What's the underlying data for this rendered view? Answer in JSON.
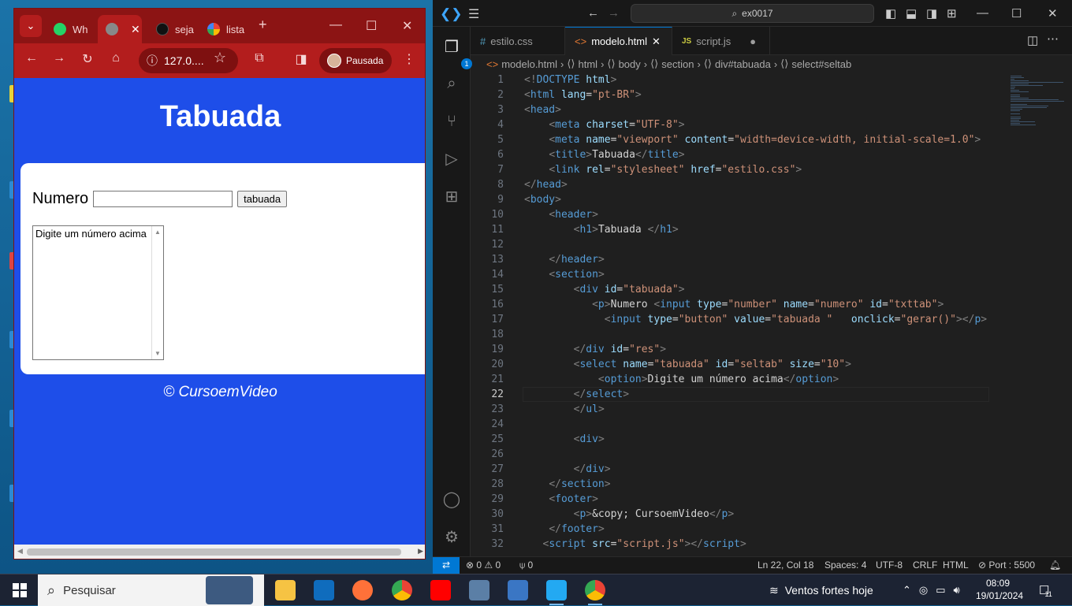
{
  "chrome": {
    "tabs": [
      {
        "label": "Wh",
        "icon": "whatsapp-icon",
        "active": false
      },
      {
        "label": "",
        "icon": "globe-icon",
        "active": true
      },
      {
        "label": "seja",
        "icon": "github-icon",
        "active": false
      },
      {
        "label": "lista",
        "icon": "google-icon",
        "active": false
      }
    ],
    "address": "127.0....",
    "profile_label": "Pausada",
    "page": {
      "title": "Tabuada",
      "number_label": "Numero",
      "button_label": "tabuada",
      "select_option": "Digite um número acima",
      "footer": "© CursoemVideo"
    },
    "accent": "#1e4ee9"
  },
  "vscode": {
    "command_center": "ex0017",
    "activity_badge": "1",
    "tabs": [
      {
        "label": "estilo.css",
        "icon": "#",
        "active": false
      },
      {
        "label": "modelo.html",
        "icon": "<>",
        "active": true
      },
      {
        "label": "script.js",
        "icon": "JS",
        "active": false
      }
    ],
    "breadcrumb": [
      "modelo.html",
      "html",
      "body",
      "section",
      "div#tabuada",
      "select#seltab"
    ],
    "lines": [
      {
        "n": "1",
        "parts": [
          [
            "t",
            "<!"
          ],
          [
            "tg",
            "DOCTYPE"
          ],
          [
            "at",
            " html"
          ],
          [
            "t",
            ">"
          ]
        ]
      },
      {
        "n": "2",
        "parts": [
          [
            "t",
            "<"
          ],
          [
            "tg",
            "html"
          ],
          [
            "at",
            " lang"
          ],
          [
            "tx",
            "="
          ],
          [
            "st",
            "\"pt-BR\""
          ],
          [
            "t",
            ">"
          ]
        ]
      },
      {
        "n": "3",
        "parts": [
          [
            "t",
            "<"
          ],
          [
            "tg",
            "head"
          ],
          [
            "t",
            ">"
          ]
        ]
      },
      {
        "n": "4",
        "parts": [
          [
            "tx",
            "    "
          ],
          [
            "t",
            "<"
          ],
          [
            "tg",
            "meta"
          ],
          [
            "at",
            " charset"
          ],
          [
            "tx",
            "="
          ],
          [
            "st",
            "\"UTF-8\""
          ],
          [
            "t",
            ">"
          ]
        ]
      },
      {
        "n": "5",
        "parts": [
          [
            "tx",
            "    "
          ],
          [
            "t",
            "<"
          ],
          [
            "tg",
            "meta"
          ],
          [
            "at",
            " name"
          ],
          [
            "tx",
            "="
          ],
          [
            "st",
            "\"viewport\""
          ],
          [
            "at",
            " content"
          ],
          [
            "tx",
            "="
          ],
          [
            "st",
            "\"width=device-width, initial-scale=1.0\""
          ],
          [
            "t",
            ">"
          ]
        ]
      },
      {
        "n": "6",
        "parts": [
          [
            "tx",
            "    "
          ],
          [
            "t",
            "<"
          ],
          [
            "tg",
            "title"
          ],
          [
            "t",
            ">"
          ],
          [
            "tx",
            "Tabuada"
          ],
          [
            "t",
            "</"
          ],
          [
            "tg",
            "title"
          ],
          [
            "t",
            ">"
          ]
        ]
      },
      {
        "n": "7",
        "parts": [
          [
            "tx",
            "    "
          ],
          [
            "t",
            "<"
          ],
          [
            "tg",
            "link"
          ],
          [
            "at",
            " rel"
          ],
          [
            "tx",
            "="
          ],
          [
            "st",
            "\"stylesheet\""
          ],
          [
            "at",
            " href"
          ],
          [
            "tx",
            "="
          ],
          [
            "st",
            "\"estilo.css\""
          ],
          [
            "t",
            ">"
          ]
        ]
      },
      {
        "n": "8",
        "parts": [
          [
            "t",
            "</"
          ],
          [
            "tg",
            "head"
          ],
          [
            "t",
            ">"
          ]
        ]
      },
      {
        "n": "9",
        "parts": [
          [
            "t",
            "<"
          ],
          [
            "tg",
            "body"
          ],
          [
            "t",
            ">"
          ]
        ]
      },
      {
        "n": "10",
        "parts": [
          [
            "tx",
            "    "
          ],
          [
            "t",
            "<"
          ],
          [
            "tg",
            "header"
          ],
          [
            "t",
            ">"
          ]
        ]
      },
      {
        "n": "11",
        "parts": [
          [
            "tx",
            "        "
          ],
          [
            "t",
            "<"
          ],
          [
            "tg",
            "h1"
          ],
          [
            "t",
            ">"
          ],
          [
            "tx",
            "Tabuada "
          ],
          [
            "t",
            "</"
          ],
          [
            "tg",
            "h1"
          ],
          [
            "t",
            ">"
          ]
        ]
      },
      {
        "n": "12",
        "parts": []
      },
      {
        "n": "13",
        "parts": [
          [
            "tx",
            "    "
          ],
          [
            "t",
            "</"
          ],
          [
            "tg",
            "header"
          ],
          [
            "t",
            ">"
          ]
        ]
      },
      {
        "n": "14",
        "parts": [
          [
            "tx",
            "    "
          ],
          [
            "t",
            "<"
          ],
          [
            "tg",
            "section"
          ],
          [
            "t",
            ">"
          ]
        ]
      },
      {
        "n": "15",
        "parts": [
          [
            "tx",
            "        "
          ],
          [
            "t",
            "<"
          ],
          [
            "tg",
            "div"
          ],
          [
            "at",
            " id"
          ],
          [
            "tx",
            "="
          ],
          [
            "st",
            "\"tabuada\""
          ],
          [
            "t",
            ">"
          ]
        ]
      },
      {
        "n": "16",
        "parts": [
          [
            "tx",
            "           "
          ],
          [
            "t",
            "<"
          ],
          [
            "tg",
            "p"
          ],
          [
            "t",
            ">"
          ],
          [
            "tx",
            "Numero "
          ],
          [
            "t",
            "<"
          ],
          [
            "tg",
            "input"
          ],
          [
            "at",
            " type"
          ],
          [
            "tx",
            "="
          ],
          [
            "st",
            "\"number\""
          ],
          [
            "at",
            " name"
          ],
          [
            "tx",
            "="
          ],
          [
            "st",
            "\"numero\""
          ],
          [
            "at",
            " id"
          ],
          [
            "tx",
            "="
          ],
          [
            "st",
            "\"txttab\""
          ],
          [
            "t",
            ">"
          ]
        ]
      },
      {
        "n": "17",
        "parts": [
          [
            "tx",
            "             "
          ],
          [
            "t",
            "<"
          ],
          [
            "tg",
            "input"
          ],
          [
            "at",
            " type"
          ],
          [
            "tx",
            "="
          ],
          [
            "st",
            "\"button\""
          ],
          [
            "at",
            " value"
          ],
          [
            "tx",
            "="
          ],
          [
            "st",
            "\"tabuada \""
          ],
          [
            "at",
            "   onclick"
          ],
          [
            "tx",
            "="
          ],
          [
            "st",
            "\"gerar()\""
          ],
          [
            "t",
            "></"
          ],
          [
            "tg",
            "p"
          ],
          [
            "t",
            ">"
          ]
        ]
      },
      {
        "n": "18",
        "parts": []
      },
      {
        "n": "19",
        "parts": [
          [
            "tx",
            "        "
          ],
          [
            "t",
            "</"
          ],
          [
            "tg",
            "div"
          ],
          [
            "at",
            " id"
          ],
          [
            "tx",
            "="
          ],
          [
            "st",
            "\"res\""
          ],
          [
            "t",
            ">"
          ]
        ]
      },
      {
        "n": "20",
        "parts": [
          [
            "tx",
            "        "
          ],
          [
            "t",
            "<"
          ],
          [
            "tg",
            "select"
          ],
          [
            "at",
            " name"
          ],
          [
            "tx",
            "="
          ],
          [
            "st",
            "\"tabuada\""
          ],
          [
            "at",
            " id"
          ],
          [
            "tx",
            "="
          ],
          [
            "st",
            "\"seltab\""
          ],
          [
            "at",
            " size"
          ],
          [
            "tx",
            "="
          ],
          [
            "st",
            "\"10\""
          ],
          [
            "t",
            ">"
          ]
        ]
      },
      {
        "n": "21",
        "parts": [
          [
            "tx",
            "            "
          ],
          [
            "t",
            "<"
          ],
          [
            "tg",
            "option"
          ],
          [
            "t",
            ">"
          ],
          [
            "tx",
            "Digite um número acima"
          ],
          [
            "t",
            "</"
          ],
          [
            "tg",
            "option"
          ],
          [
            "t",
            ">"
          ]
        ]
      },
      {
        "n": "22",
        "parts": [
          [
            "tx",
            "        "
          ],
          [
            "t",
            "</"
          ],
          [
            "tg",
            "select"
          ],
          [
            "t",
            ">"
          ]
        ]
      },
      {
        "n": "23",
        "parts": [
          [
            "tx",
            "        "
          ],
          [
            "t",
            "</"
          ],
          [
            "tg",
            "ul"
          ],
          [
            "t",
            ">"
          ]
        ]
      },
      {
        "n": "24",
        "parts": []
      },
      {
        "n": "25",
        "parts": [
          [
            "tx",
            "        "
          ],
          [
            "t",
            "<"
          ],
          [
            "tg",
            "div"
          ],
          [
            "t",
            ">"
          ]
        ]
      },
      {
        "n": "26",
        "parts": []
      },
      {
        "n": "27",
        "parts": [
          [
            "tx",
            "        "
          ],
          [
            "t",
            "</"
          ],
          [
            "tg",
            "div"
          ],
          [
            "t",
            ">"
          ]
        ]
      },
      {
        "n": "28",
        "parts": [
          [
            "tx",
            "    "
          ],
          [
            "t",
            "</"
          ],
          [
            "tg",
            "section"
          ],
          [
            "t",
            ">"
          ]
        ]
      },
      {
        "n": "29",
        "parts": [
          [
            "tx",
            "    "
          ],
          [
            "t",
            "<"
          ],
          [
            "tg",
            "footer"
          ],
          [
            "t",
            ">"
          ]
        ]
      },
      {
        "n": "30",
        "parts": [
          [
            "tx",
            "        "
          ],
          [
            "t",
            "<"
          ],
          [
            "tg",
            "p"
          ],
          [
            "t",
            ">"
          ],
          [
            "tx",
            "&copy; CursoemVideo"
          ],
          [
            "t",
            "</"
          ],
          [
            "tg",
            "p"
          ],
          [
            "t",
            ">"
          ]
        ]
      },
      {
        "n": "31",
        "parts": [
          [
            "tx",
            "    "
          ],
          [
            "t",
            "</"
          ],
          [
            "tg",
            "footer"
          ],
          [
            "t",
            ">"
          ]
        ]
      },
      {
        "n": "32",
        "parts": [
          [
            "tx",
            "   "
          ],
          [
            "t",
            "<"
          ],
          [
            "tg",
            "script"
          ],
          [
            "at",
            " src"
          ],
          [
            "tx",
            "="
          ],
          [
            "st",
            "\"script.js\""
          ],
          [
            "t",
            "></"
          ],
          [
            "tg",
            "script"
          ],
          [
            "t",
            ">"
          ]
        ]
      }
    ],
    "current_line": "22",
    "status": {
      "errors": "0",
      "warnings": "0",
      "ports": "0",
      "position": "Ln 22, Col 18",
      "spaces": "Spaces: 4",
      "encoding": "UTF-8",
      "eol": "CRLF",
      "language": "HTML",
      "port": "Port : 5500"
    }
  },
  "taskbar": {
    "search_placeholder": "Pesquisar",
    "weather": "Ventos fortes hoje",
    "time": "08:09",
    "date": "19/01/2024",
    "notifications": "11"
  }
}
